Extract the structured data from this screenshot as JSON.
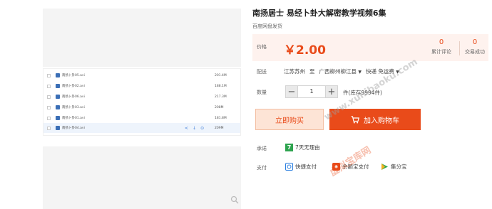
{
  "product": {
    "title": "南扬居士 易经卜卦大解密教学视频6集",
    "subtitle": "百度网盘发货"
  },
  "files": [
    {
      "name": "南扬卜卦05.avi",
      "size": "201.4M"
    },
    {
      "name": "南扬卜卦02.avi",
      "size": "188.1M"
    },
    {
      "name": "南扬卜卦06.avi",
      "size": "217.3M"
    },
    {
      "name": "南扬卜卦03.avi",
      "size": "208M"
    },
    {
      "name": "南扬卜卦01.avi",
      "size": "181.8M"
    },
    {
      "name": "南扬卜卦04.avi",
      "size": "209M"
    }
  ],
  "price": {
    "label": "价格",
    "value": "￥2.00",
    "reviews_count": "0",
    "reviews_label": "累计评论",
    "deals_count": "0",
    "deals_label": "交易成功"
  },
  "shipping": {
    "label": "配送",
    "from": "江苏苏州",
    "to_word": "至",
    "to": "广西柳州柳江县",
    "method": "快递 免运费"
  },
  "quantity": {
    "label": "数量",
    "value": "1",
    "minus": "−",
    "plus": "+",
    "stock_text": "件(库存9994件)"
  },
  "actions": {
    "buy_now": "立即购买",
    "add_cart": "加入购物车"
  },
  "promise": {
    "label": "承诺",
    "badge": "7",
    "text": "7天无理由"
  },
  "payment": {
    "label": "支付",
    "methods": [
      "快捷支付",
      "余额宝支付",
      "集分宝"
    ]
  },
  "watermarks": {
    "url": "www.xunibaoku.com",
    "brand": "虚拟宝库网"
  },
  "colors": {
    "accent": "#e94b1a",
    "price_bg": "#fef2ee"
  }
}
